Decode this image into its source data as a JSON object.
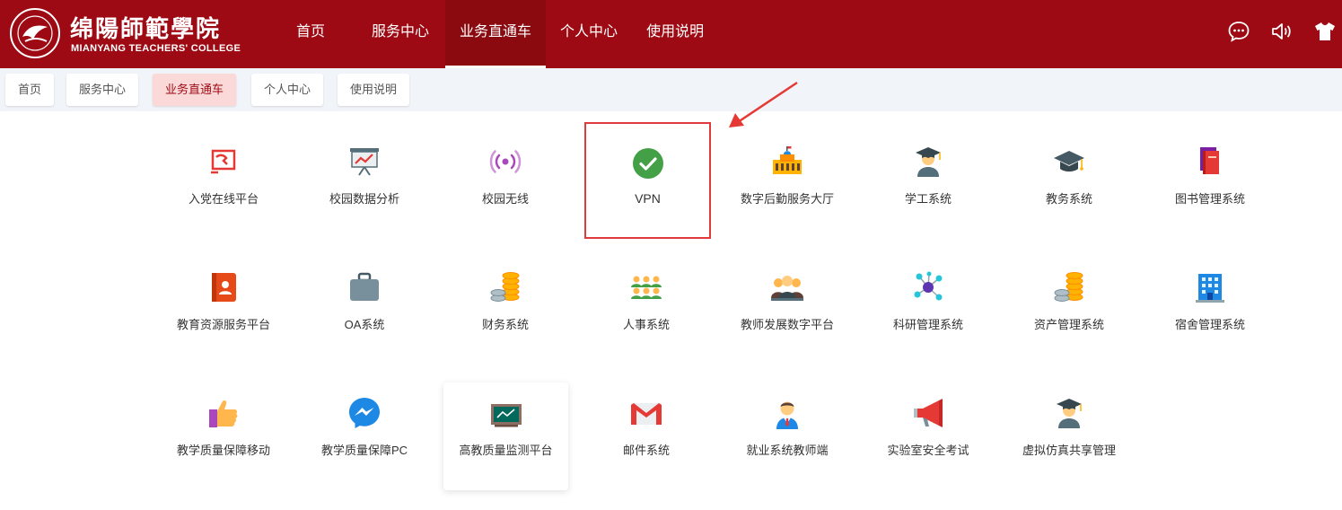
{
  "header": {
    "logo_cn": "绵陽師範學院",
    "logo_en": "MIANYANG TEACHERS' COLLEGE",
    "nav": [
      {
        "label": "首页",
        "active": false
      },
      {
        "label": "服务中心",
        "active": false
      },
      {
        "label": "业务直通车",
        "active": true
      },
      {
        "label": "个人中心",
        "active": false
      },
      {
        "label": "使用说明",
        "active": false
      }
    ],
    "icons": [
      "chat-icon",
      "speaker-icon",
      "tshirt-icon"
    ]
  },
  "tabs": [
    {
      "label": "首页",
      "active": false
    },
    {
      "label": "服务中心",
      "active": false
    },
    {
      "label": "业务直通车",
      "active": true
    },
    {
      "label": "个人中心",
      "active": false
    },
    {
      "label": "使用说明",
      "active": false
    }
  ],
  "apps": [
    {
      "label": "入党在线平台",
      "icon": "party-flag-icon"
    },
    {
      "label": "校园数据分析",
      "icon": "presentation-chart-icon"
    },
    {
      "label": "校园无线",
      "icon": "wireless-signal-icon"
    },
    {
      "label": "VPN",
      "icon": "check-circle-icon"
    },
    {
      "label": "数字后勤服务大厅",
      "icon": "building-icon"
    },
    {
      "label": "学工系统",
      "icon": "graduate-person-icon"
    },
    {
      "label": "教务系统",
      "icon": "graduation-cap-icon"
    },
    {
      "label": "图书管理系统",
      "icon": "books-icon"
    },
    {
      "label": "教育资源服务平台",
      "icon": "contact-book-icon"
    },
    {
      "label": "OA系统",
      "icon": "briefcase-icon"
    },
    {
      "label": "财务系统",
      "icon": "coins-icon"
    },
    {
      "label": "人事系统",
      "icon": "people-group-icon"
    },
    {
      "label": "教师发展数字平台",
      "icon": "teachers-icon"
    },
    {
      "label": "科研管理系统",
      "icon": "molecule-icon"
    },
    {
      "label": "资产管理系统",
      "icon": "coins-stack-icon"
    },
    {
      "label": "宿舍管理系统",
      "icon": "dormitory-building-icon"
    },
    {
      "label": "教学质量保障移动",
      "icon": "thumbs-up-icon"
    },
    {
      "label": "教学质量保障PC",
      "icon": "messenger-icon"
    },
    {
      "label": "高教质量监测平台",
      "icon": "blackboard-icon"
    },
    {
      "label": "邮件系统",
      "icon": "mail-icon"
    },
    {
      "label": "就业系统教师端",
      "icon": "businessman-icon"
    },
    {
      "label": "实验室安全考试",
      "icon": "megaphone-icon"
    },
    {
      "label": "虚拟仿真共享管理",
      "icon": "graduate-person-icon"
    }
  ],
  "colors": {
    "header_bg": "#9e0a13",
    "active_tab_bg": "#fbd9d9",
    "highlight_border": "#e03a3a"
  }
}
